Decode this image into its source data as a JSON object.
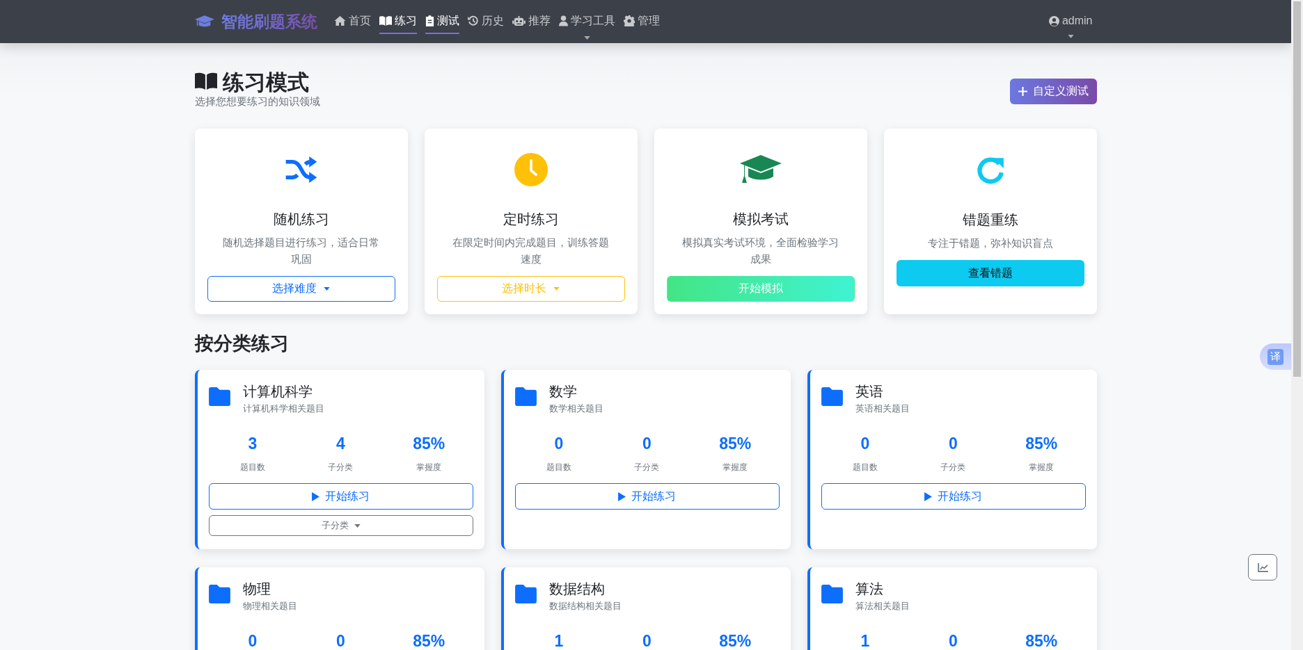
{
  "navbar": {
    "brand": "智能刷题系统",
    "items": [
      {
        "label": "首页",
        "selected": false,
        "dropdown": false
      },
      {
        "label": "练习",
        "selected": true,
        "dropdown": false
      },
      {
        "label": "测试",
        "selected": true,
        "dropdown": false
      },
      {
        "label": "历史",
        "selected": false,
        "dropdown": false
      },
      {
        "label": "推荐",
        "selected": false,
        "dropdown": false
      },
      {
        "label": "学习工具",
        "selected": false,
        "dropdown": true
      },
      {
        "label": "管理",
        "selected": false,
        "dropdown": false
      }
    ],
    "user": {
      "label": "admin",
      "dropdown": true
    }
  },
  "header": {
    "title": "练习模式",
    "subtitle": "选择您想要练习的知识领域",
    "action_button": "自定义测试"
  },
  "modes": [
    {
      "title": "随机练习",
      "description": "随机选择题目进行练习，适合日常巩固",
      "button": {
        "label": "选择难度",
        "kind": "outline",
        "color": "#0d6efd",
        "dropdown": true
      }
    },
    {
      "title": "定时练习",
      "description": "在限定时间内完成题目，训练答题速度",
      "button": {
        "label": "选择时长",
        "kind": "outline",
        "color": "#ffc107",
        "dropdown": true
      }
    },
    {
      "title": "模拟考试",
      "description": "模拟真实考试环境，全面检验学习成果",
      "button": {
        "label": "开始模拟",
        "kind": "gradient",
        "dropdown": false
      }
    },
    {
      "title": "错题重练",
      "description": "专注于错题，弥补知识盲点",
      "button": {
        "label": "查看错题",
        "kind": "solid",
        "color": "#0dcaf0",
        "dropdown": false
      }
    }
  ],
  "category_section": {
    "title": "按分类练习",
    "categories": [
      {
        "name": "计算机科学",
        "description": "计算机科学相关题目",
        "stats": [
          {
            "value": "3",
            "label": "题目数"
          },
          {
            "value": "4",
            "label": "子分类"
          },
          {
            "value": "85%",
            "label": "掌握度"
          }
        ],
        "button": "开始练习",
        "subcategory_button": "子分类"
      },
      {
        "name": "数学",
        "description": "数学相关题目",
        "stats": [
          {
            "value": "0",
            "label": "题目数"
          },
          {
            "value": "0",
            "label": "子分类"
          },
          {
            "value": "85%",
            "label": "掌握度"
          }
        ],
        "button": "开始练习"
      },
      {
        "name": "英语",
        "description": "英语相关题目",
        "stats": [
          {
            "value": "0",
            "label": "题目数"
          },
          {
            "value": "0",
            "label": "子分类"
          },
          {
            "value": "85%",
            "label": "掌握度"
          }
        ],
        "button": "开始练习"
      },
      {
        "name": "物理",
        "description": "物理相关题目",
        "stats": [
          {
            "value": "0"
          },
          {
            "value": "0"
          },
          {
            "value": "85%"
          }
        ]
      },
      {
        "name": "数据结构",
        "description": "数据结构相关题目",
        "stats": [
          {
            "value": "1"
          },
          {
            "value": "0"
          },
          {
            "value": "85%"
          }
        ]
      },
      {
        "name": "算法",
        "description": "算法相关题目",
        "stats": [
          {
            "value": "1"
          },
          {
            "value": "0"
          },
          {
            "value": "85%"
          }
        ]
      }
    ]
  },
  "floating": {
    "translate_button": "译"
  }
}
